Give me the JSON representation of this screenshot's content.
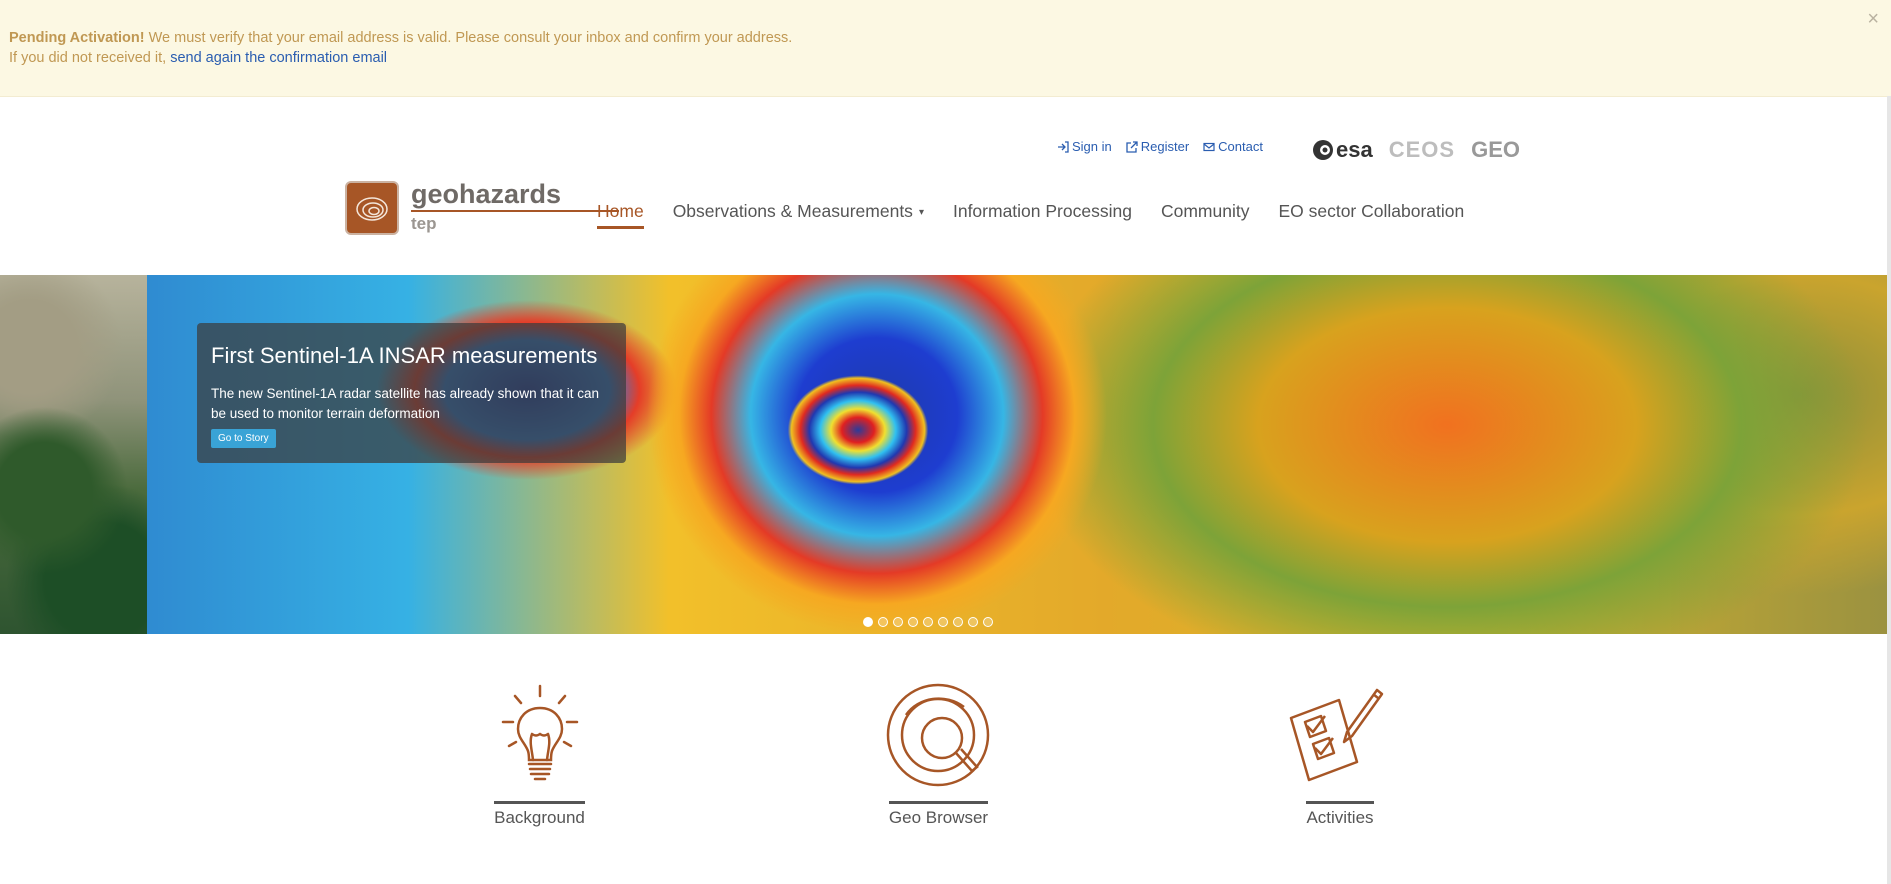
{
  "alert": {
    "title": "Pending Activation!",
    "message": " We must verify that your email address is valid. Please consult your inbox and confirm your address.",
    "line2_prefix": "If you did not received it, ",
    "link": "send again the confirmation email",
    "close": "×"
  },
  "top_links": {
    "sign_in": "Sign in",
    "register": "Register",
    "contact": "Contact"
  },
  "partners": {
    "esa": "esa",
    "ceos": "CEOS",
    "geo": "GEO"
  },
  "logo": {
    "title": "geohazards",
    "subtitle": "tep"
  },
  "nav": {
    "items": [
      {
        "label": "Home",
        "active": true
      },
      {
        "label": "Observations & Measurements",
        "dropdown": true
      },
      {
        "label": "Information Processing"
      },
      {
        "label": "Community"
      },
      {
        "label": "EO sector Collaboration"
      }
    ]
  },
  "hero": {
    "title": "First Sentinel-1A INSAR measurements",
    "text": "The new Sentinel-1A radar satellite has already shown that it can be used to monitor terrain deformation",
    "button": "Go to Story",
    "slide_count": 9,
    "active_slide": 1
  },
  "features": [
    {
      "label": "Background",
      "icon": "lightbulb-icon"
    },
    {
      "label": "Geo Browser",
      "icon": "magnifier-globe-icon"
    },
    {
      "label": "Activities",
      "icon": "checklist-icon"
    }
  ],
  "colors": {
    "accent": "#a75626",
    "link": "#2a5db0",
    "alert_bg": "#fcf8e3",
    "alert_text": "#c09853"
  }
}
